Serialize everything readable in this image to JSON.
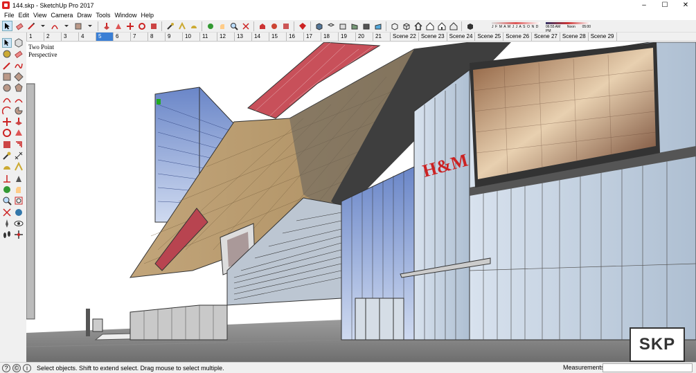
{
  "window": {
    "title": "144.skp - SketchUp Pro 2017",
    "controls": [
      "–",
      "☐",
      "✕"
    ]
  },
  "menu": [
    "File",
    "Edit",
    "View",
    "Camera",
    "Draw",
    "Tools",
    "Window",
    "Help"
  ],
  "shadow_settings": {
    "months": "J F M A M J J A S O N D",
    "times": [
      "06:55 AM",
      "Noon",
      "05:00 PM"
    ]
  },
  "scenes": [
    "1",
    "2",
    "3",
    "4",
    "5",
    "6",
    "7",
    "8",
    "9",
    "10",
    "11",
    "12",
    "13",
    "14",
    "15",
    "16",
    "17",
    "18",
    "19",
    "20",
    "21",
    "Scene 22",
    "Scene 23",
    "Scene 24",
    "Scene 25",
    "Scene 26",
    "Scene 27",
    "Scene 28",
    "Scene 29"
  ],
  "active_scene": "5",
  "viewport": {
    "camera_label": [
      "Two Point",
      "Perspective"
    ],
    "logo": "SKP"
  },
  "status": {
    "message": "Select objects. Shift to extend select. Drag mouse to select multiple.",
    "measurements_label": "Measurements"
  },
  "colors": {
    "accent": "#3a7fd5",
    "brand": "#dd2222"
  }
}
